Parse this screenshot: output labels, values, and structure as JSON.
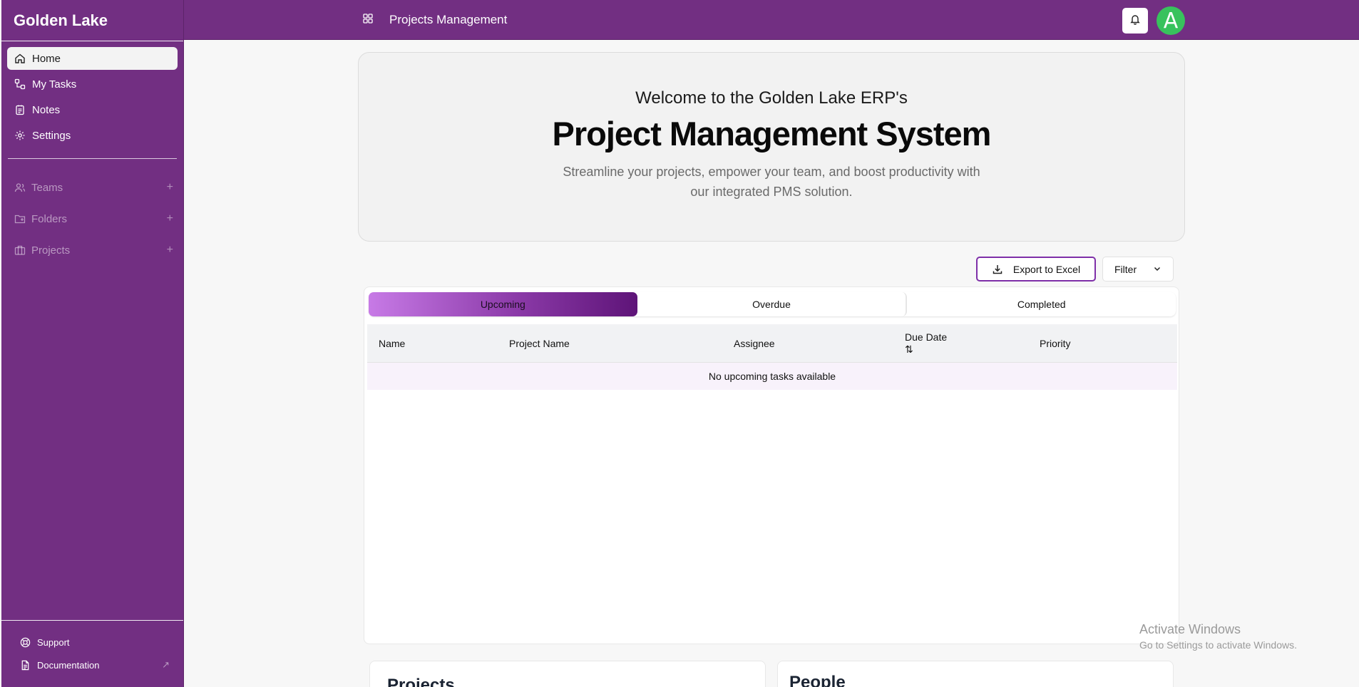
{
  "sidebar": {
    "brand": "Golden Lake",
    "nav": [
      {
        "label": "Home",
        "icon": "home-icon",
        "active": true
      },
      {
        "label": "My Tasks",
        "icon": "tasks-icon",
        "active": false
      },
      {
        "label": "Notes",
        "icon": "notes-icon",
        "active": false
      },
      {
        "label": "Settings",
        "icon": "gear-icon",
        "active": false
      }
    ],
    "groups": [
      {
        "label": "Teams",
        "icon": "users-icon",
        "action": "+"
      },
      {
        "label": "Folders",
        "icon": "folder-icon",
        "action": "+"
      },
      {
        "label": "Projects",
        "icon": "briefcase-icon",
        "action": "+"
      }
    ],
    "footer": [
      {
        "label": "Support",
        "icon": "lifebuoy-icon"
      },
      {
        "label": "Documentation",
        "icon": "document-icon",
        "external": "↗"
      }
    ]
  },
  "topbar": {
    "title": "Projects Management",
    "avatar_initial": "A",
    "colors": {
      "bar": "#722f82",
      "avatar": "#38c25d"
    }
  },
  "hero": {
    "pre_title": "Welcome to the Golden Lake ERP's",
    "title": "Project Management System",
    "subtitle": "Streamline your projects, empower your team, and boost productivity with our integrated PMS solution."
  },
  "actions": {
    "export_label": "Export to Excel",
    "filter_label": "Filter"
  },
  "tasks": {
    "tabs": [
      {
        "label": "Upcoming",
        "active": true
      },
      {
        "label": "Overdue",
        "active": false
      },
      {
        "label": "Completed",
        "active": false
      }
    ],
    "columns": [
      "Name",
      "Project Name",
      "Assignee",
      "Due Date",
      "Priority"
    ],
    "sort_indicator": "⇅",
    "empty_message": "No upcoming tasks available"
  },
  "sections": {
    "projects_title": "Projects",
    "people_title": "People"
  },
  "watermark": {
    "line1": "Activate Windows",
    "line2": "Go to Settings to activate Windows."
  }
}
